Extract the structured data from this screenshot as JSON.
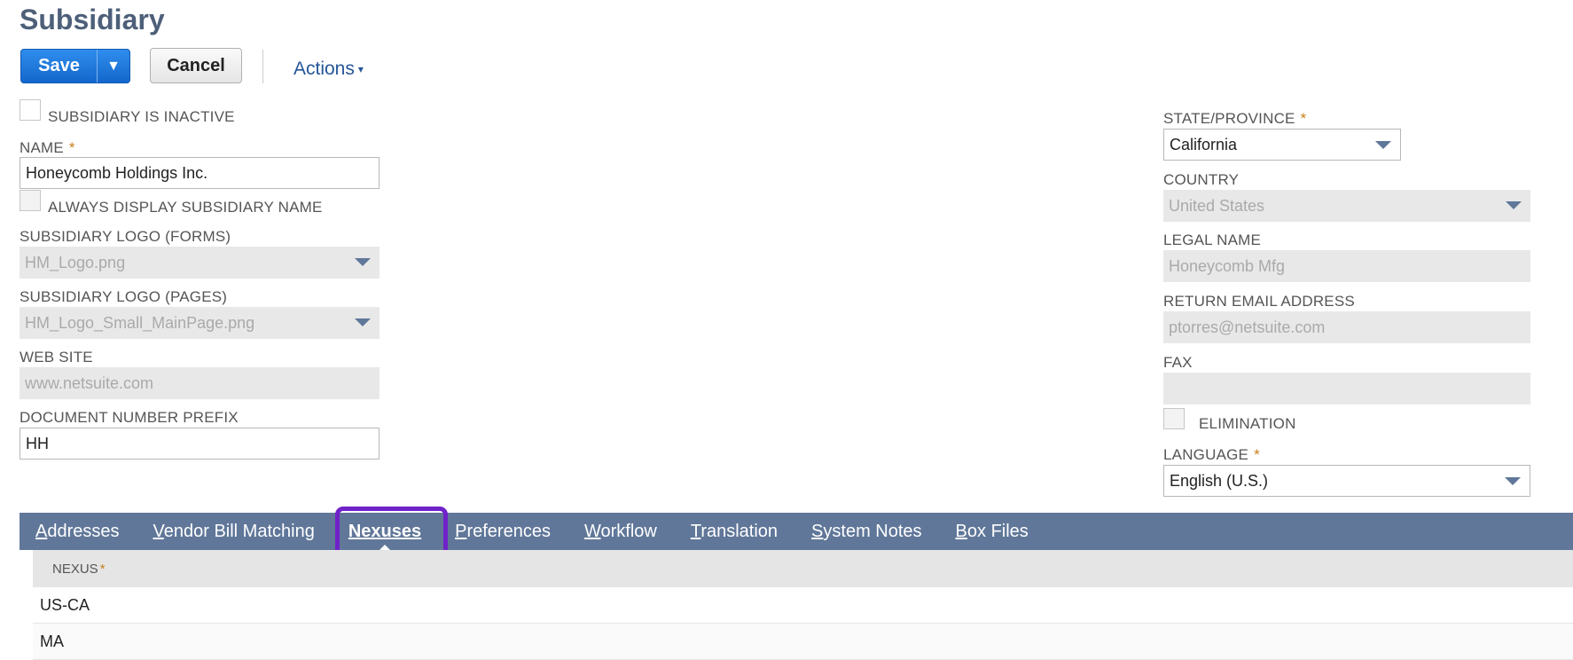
{
  "page": {
    "title": "Subsidiary"
  },
  "toolbar": {
    "save_label": "Save",
    "save_menu_icon": "▼",
    "cancel_label": "Cancel",
    "actions_label": "Actions",
    "actions_caret": "▾"
  },
  "left": {
    "inactive_label": "SUBSIDIARY IS INACTIVE",
    "name_label": "NAME",
    "name_value": "Honeycomb Holdings Inc.",
    "always_display_label": "ALWAYS DISPLAY SUBSIDIARY NAME",
    "logo_forms_label": "SUBSIDIARY LOGO (FORMS)",
    "logo_forms_value": "HM_Logo.png",
    "logo_pages_label": "SUBSIDIARY LOGO (PAGES)",
    "logo_pages_value": "HM_Logo_Small_MainPage.png",
    "website_label": "WEB SITE",
    "website_value": "www.netsuite.com",
    "doc_prefix_label": "DOCUMENT NUMBER PREFIX",
    "doc_prefix_value": "HH"
  },
  "right": {
    "state_label": "STATE/PROVINCE",
    "state_value": "California",
    "country_label": "COUNTRY",
    "country_value": "United States",
    "legal_name_label": "LEGAL NAME",
    "legal_name_value": "Honeycomb Mfg",
    "return_email_label": "RETURN EMAIL ADDRESS",
    "return_email_value": "ptorres@netsuite.com",
    "fax_label": "FAX",
    "fax_value": "",
    "elimination_label": "ELIMINATION",
    "language_label": "LANGUAGE",
    "language_value": "English (U.S.)"
  },
  "required_marker": "*",
  "tabs": [
    {
      "key": "A",
      "rest": "ddresses"
    },
    {
      "key": "V",
      "rest": "endor Bill Matching"
    },
    {
      "key": "",
      "rest": "Nexuses"
    },
    {
      "key": "P",
      "rest": "references"
    },
    {
      "key": "W",
      "rest": "orkflow"
    },
    {
      "key": "T",
      "rest": "ranslation"
    },
    {
      "key": "S",
      "rest": "ystem Notes"
    },
    {
      "key": "B",
      "rest": "ox Files"
    }
  ],
  "nexus_table": {
    "header": "NEXUS",
    "rows": [
      "US-CA",
      "MA"
    ]
  }
}
